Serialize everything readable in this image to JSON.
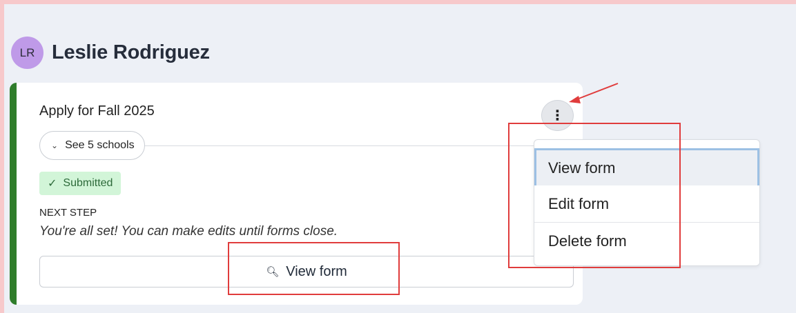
{
  "user": {
    "initials": "LR",
    "name": "Leslie Rodriguez"
  },
  "card": {
    "title": "Apply for Fall 2025",
    "kebab_icon": "⋮",
    "schools_toggle_label": "See 5 schools",
    "status_badge": "Submitted",
    "next_step_label": "NEXT STEP",
    "next_step_text": "You're all set! You can make edits until forms close.",
    "view_button_label": "View form"
  },
  "menu": {
    "items": [
      {
        "label": "View form"
      },
      {
        "label": "Edit form"
      },
      {
        "label": "Delete form"
      }
    ]
  },
  "colors": {
    "accent_bar": "#2f7d2b",
    "badge_bg": "#d2f5d8",
    "avatar_bg": "#bf9ae8",
    "annotation": "#e03c3c"
  }
}
